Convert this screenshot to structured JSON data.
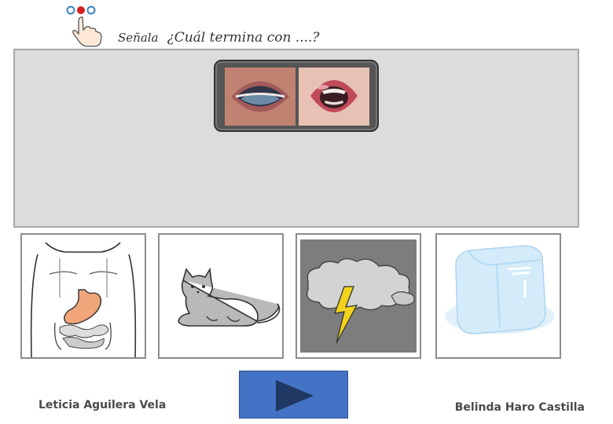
{
  "header": {
    "instruction_lead": "Señala",
    "question": "¿Cuál termina con ....?",
    "icon": "pointing-hand-icon"
  },
  "mouth_images": [
    {
      "name": "mouth-position-1"
    },
    {
      "name": "mouth-position-2"
    }
  ],
  "answer_cards": [
    {
      "name": "stomach-card",
      "icon": "body-stomach-illustration"
    },
    {
      "name": "cat-card",
      "icon": "cat-illustration"
    },
    {
      "name": "storm-card",
      "icon": "storm-cloud-lightning-illustration"
    },
    {
      "name": "ice-card",
      "icon": "ice-cube-illustration"
    }
  ],
  "footer": {
    "author_left": "Leticia Aguilera Vela",
    "author_right": "Belinda Haro Castilla",
    "next_icon": "play-arrow-icon"
  },
  "colors": {
    "stage": "#dcdcdc",
    "button": "#4472c4",
    "button_arrow": "#1f3864"
  }
}
